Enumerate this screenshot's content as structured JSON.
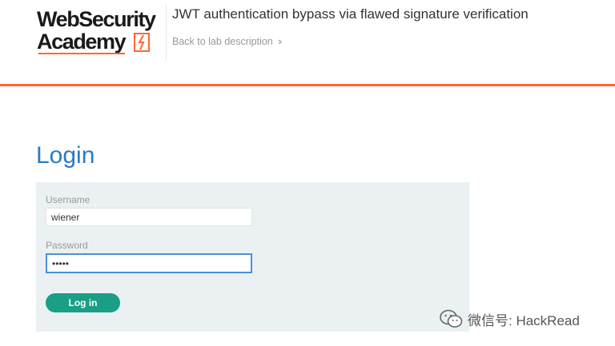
{
  "header": {
    "logo_line1": "WebSecurity",
    "logo_line2": "Academy",
    "lab_title": "JWT authentication bypass via flawed signature verification",
    "back_link_label": "Back to lab description",
    "accent_color": "#ff6633"
  },
  "login": {
    "title": "Login",
    "username_label": "Username",
    "username_value": "wiener",
    "password_label": "Password",
    "password_value": "peter",
    "button_label": "Log in",
    "button_color": "#1a9e85",
    "title_color": "#2b7bc0"
  },
  "watermark": {
    "text": "微信号: HackRead",
    "icon": "wechat-icon"
  }
}
